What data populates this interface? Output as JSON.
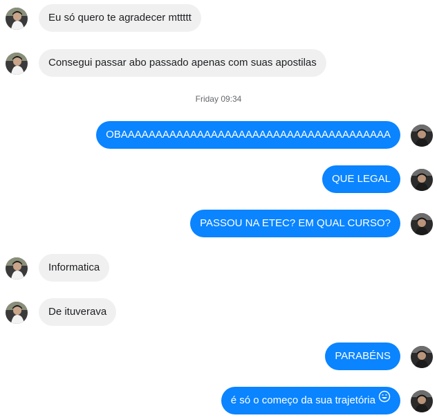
{
  "conversation": {
    "timestamp": "Friday 09:34",
    "messages": [
      {
        "text": "Eu só quero te agradecer mttttt"
      },
      {
        "text": "Consegui passar abo passado apenas com suas apostilas"
      },
      {
        "text": "OBAAAAAAAAAAAAAAAAAAAAAAAAAAAAAAAAAAAAAAA"
      },
      {
        "text": "QUE LEGAL"
      },
      {
        "text": "PASSOU NA ETEC? EM QUAL CURSO?"
      },
      {
        "text": "Informatica"
      },
      {
        "text": "De ituverava"
      },
      {
        "text": "PARABÉNS"
      },
      {
        "text": "é só o começo da sua trajetória",
        "emoji": "grinning-face-emoji"
      }
    ]
  },
  "colors": {
    "outgoing_bubble": "#0a84ff",
    "incoming_bubble": "#f0f0f0"
  }
}
